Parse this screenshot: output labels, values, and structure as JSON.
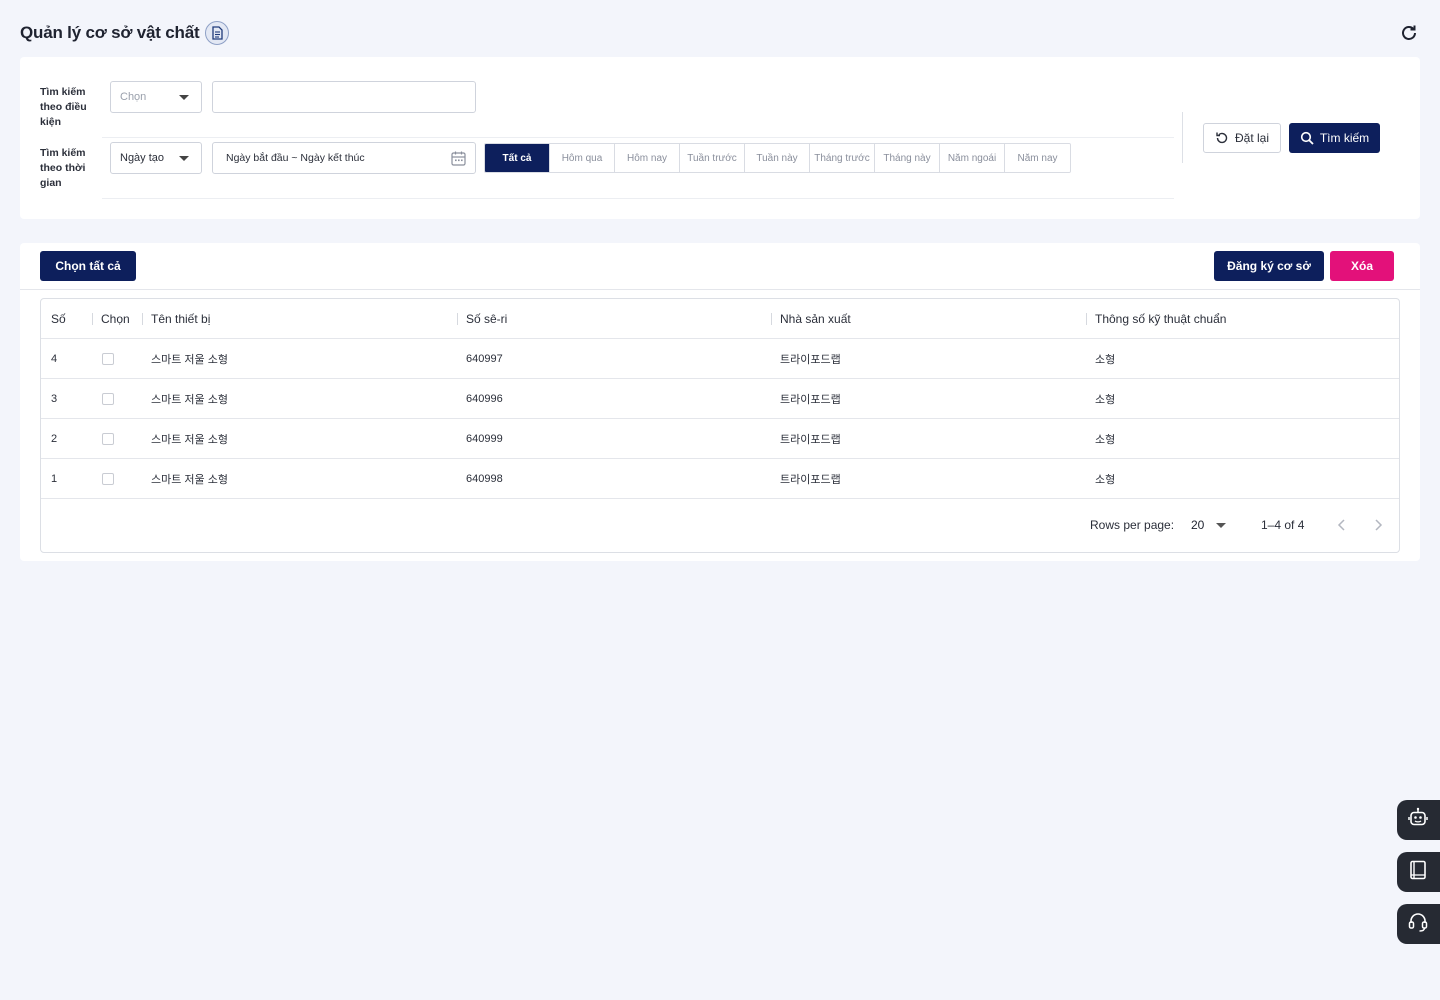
{
  "header": {
    "title": "Quản lý cơ sở vật chất",
    "doc_icon": "document-icon",
    "refresh_icon": "refresh-icon"
  },
  "search": {
    "condition_label": "Tìm kiếm theo điều kiện",
    "condition_select": "Chọn",
    "condition_input_value": "",
    "time_label": "Tìm kiếm theo thời gian",
    "time_select": "Ngày tạo",
    "date_range": "Ngày bắt đầu ~ Ngày kết thúc",
    "quick_ranges": [
      "Tất cả",
      "Hôm qua",
      "Hôm nay",
      "Tuần trước",
      "Tuần này",
      "Tháng trước",
      "Tháng này",
      "Năm ngoái",
      "Năm nay"
    ],
    "active_range": "Tất cả",
    "reset_label": "Đặt lại",
    "search_label": "Tìm kiếm"
  },
  "toolbar": {
    "select_all_label": "Chọn tất cả",
    "register_label": "Đăng ký cơ sở",
    "delete_label": "Xóa"
  },
  "table": {
    "columns": [
      "Số",
      "Chọn",
      "Tên thiết bị",
      "Số sê-ri",
      "Nhà sản xuất",
      "Thông số kỹ thuật chuẩn"
    ],
    "rows": [
      {
        "no": "4",
        "checked": false,
        "name": "스마트 저울 소형",
        "serial": "640997",
        "maker": "트라이포드랩",
        "spec": "소형"
      },
      {
        "no": "3",
        "checked": false,
        "name": "스마트 저울 소형",
        "serial": "640996",
        "maker": "트라이포드랩",
        "spec": "소형"
      },
      {
        "no": "2",
        "checked": false,
        "name": "스마트 저울 소형",
        "serial": "640999",
        "maker": "트라이포드랩",
        "spec": "소형"
      },
      {
        "no": "1",
        "checked": false,
        "name": "스마트 저울 소형",
        "serial": "640998",
        "maker": "트라이포드랩",
        "spec": "소형"
      }
    ]
  },
  "pagination": {
    "rows_per_page_label": "Rows per page:",
    "rows_per_page": "20",
    "range_text": "1–4 of 4"
  },
  "floating": [
    "robot-icon",
    "book-icon",
    "headset-icon"
  ],
  "colors": {
    "navy": "#0d1f5c",
    "pink": "#e3117a",
    "background": "#f3f5fb"
  }
}
